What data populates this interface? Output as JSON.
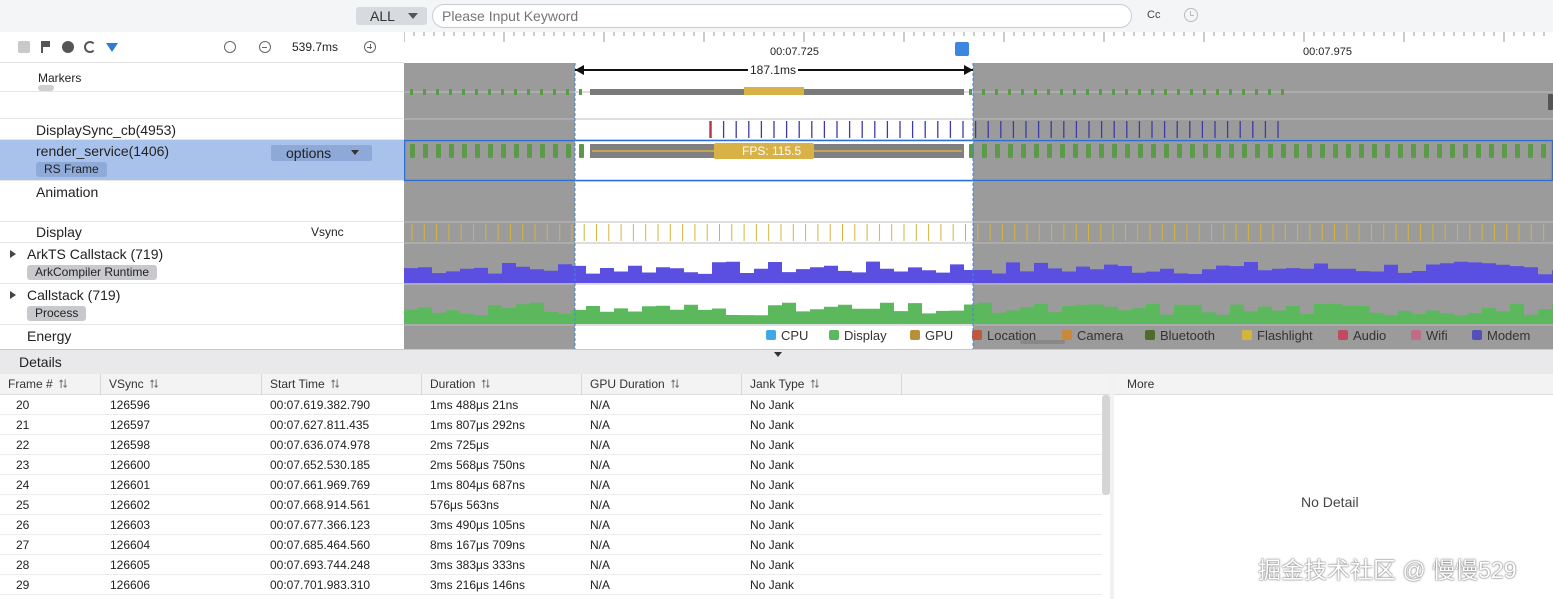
{
  "search": {
    "type_value": "ALL",
    "placeholder": "Please Input Keyword",
    "case_label": "Cc"
  },
  "toolbar": {
    "zoom_value": "539.7ms",
    "icons": [
      "square-icon",
      "flag-icon",
      "globe-icon",
      "sync-icon",
      "filter-icon",
      "timer-icon",
      "zoom-out-icon",
      "zoom-in-icon"
    ]
  },
  "ruler": {
    "time_marks": [
      "00:07.725",
      "00:07.975"
    ],
    "range_label": "187.1ms"
  },
  "lanes": {
    "markers": "Markers",
    "displaysync": "DisplaySync_cb(4953)",
    "render_service": "render_service(1406)",
    "render_tag": "RS Frame",
    "options": "options",
    "animation": "Animation",
    "display": "Display",
    "display_right": "Vsync",
    "arkts": "ArkTS Callstack (719)",
    "arkts_tag": "ArkCompiler Runtime",
    "callstack": "Callstack (719)",
    "callstack_tag": "Process",
    "energy": "Energy"
  },
  "fps_label": "FPS: 115.5",
  "legend": [
    {
      "label": "CPU",
      "color": "#3fa9e6"
    },
    {
      "label": "Display",
      "color": "#5cb85c"
    },
    {
      "label": "GPU",
      "color": "#b8903a"
    },
    {
      "label": "Location",
      "color": "#c0593a"
    },
    {
      "label": "Camera",
      "color": "#c88a3a"
    },
    {
      "label": "Bluetooth",
      "color": "#4f6b2a"
    },
    {
      "label": "Flashlight",
      "color": "#d4b43c"
    },
    {
      "label": "Audio",
      "color": "#c04a60"
    },
    {
      "label": "Wifi",
      "color": "#c06c86"
    },
    {
      "label": "Modem",
      "color": "#5550b8"
    }
  ],
  "details": {
    "title": "Details",
    "more_label": "More",
    "no_detail": "No Detail",
    "sort_glyph": "⮁",
    "columns": [
      "Frame #",
      "VSync",
      "Start Time",
      "Duration",
      "GPU Duration",
      "Jank Type"
    ],
    "rows": [
      [
        "20",
        "126596",
        "00:07.619.382.790",
        "1ms 488μs 21ns",
        "N/A",
        "No Jank"
      ],
      [
        "21",
        "126597",
        "00:07.627.811.435",
        "1ms 807μs 292ns",
        "N/A",
        "No Jank"
      ],
      [
        "22",
        "126598",
        "00:07.636.074.978",
        "2ms 725μs",
        "N/A",
        "No Jank"
      ],
      [
        "23",
        "126600",
        "00:07.652.530.185",
        "2ms 568μs 750ns",
        "N/A",
        "No Jank"
      ],
      [
        "24",
        "126601",
        "00:07.661.969.769",
        "1ms 804μs 687ns",
        "N/A",
        "No Jank"
      ],
      [
        "25",
        "126602",
        "00:07.668.914.561",
        "576μs 563ns",
        "N/A",
        "No Jank"
      ],
      [
        "26",
        "126603",
        "00:07.677.366.123",
        "3ms 490μs 105ns",
        "N/A",
        "No Jank"
      ],
      [
        "27",
        "126604",
        "00:07.685.464.560",
        "8ms 167μs 709ns",
        "N/A",
        "No Jank"
      ],
      [
        "28",
        "126605",
        "00:07.693.744.248",
        "3ms 383μs 333ns",
        "N/A",
        "No Jank"
      ],
      [
        "29",
        "126606",
        "00:07.701.983.310",
        "3ms 216μs 146ns",
        "N/A",
        "No Jank"
      ]
    ]
  },
  "watermark": "掘金技术社区 @ 慢慢529"
}
